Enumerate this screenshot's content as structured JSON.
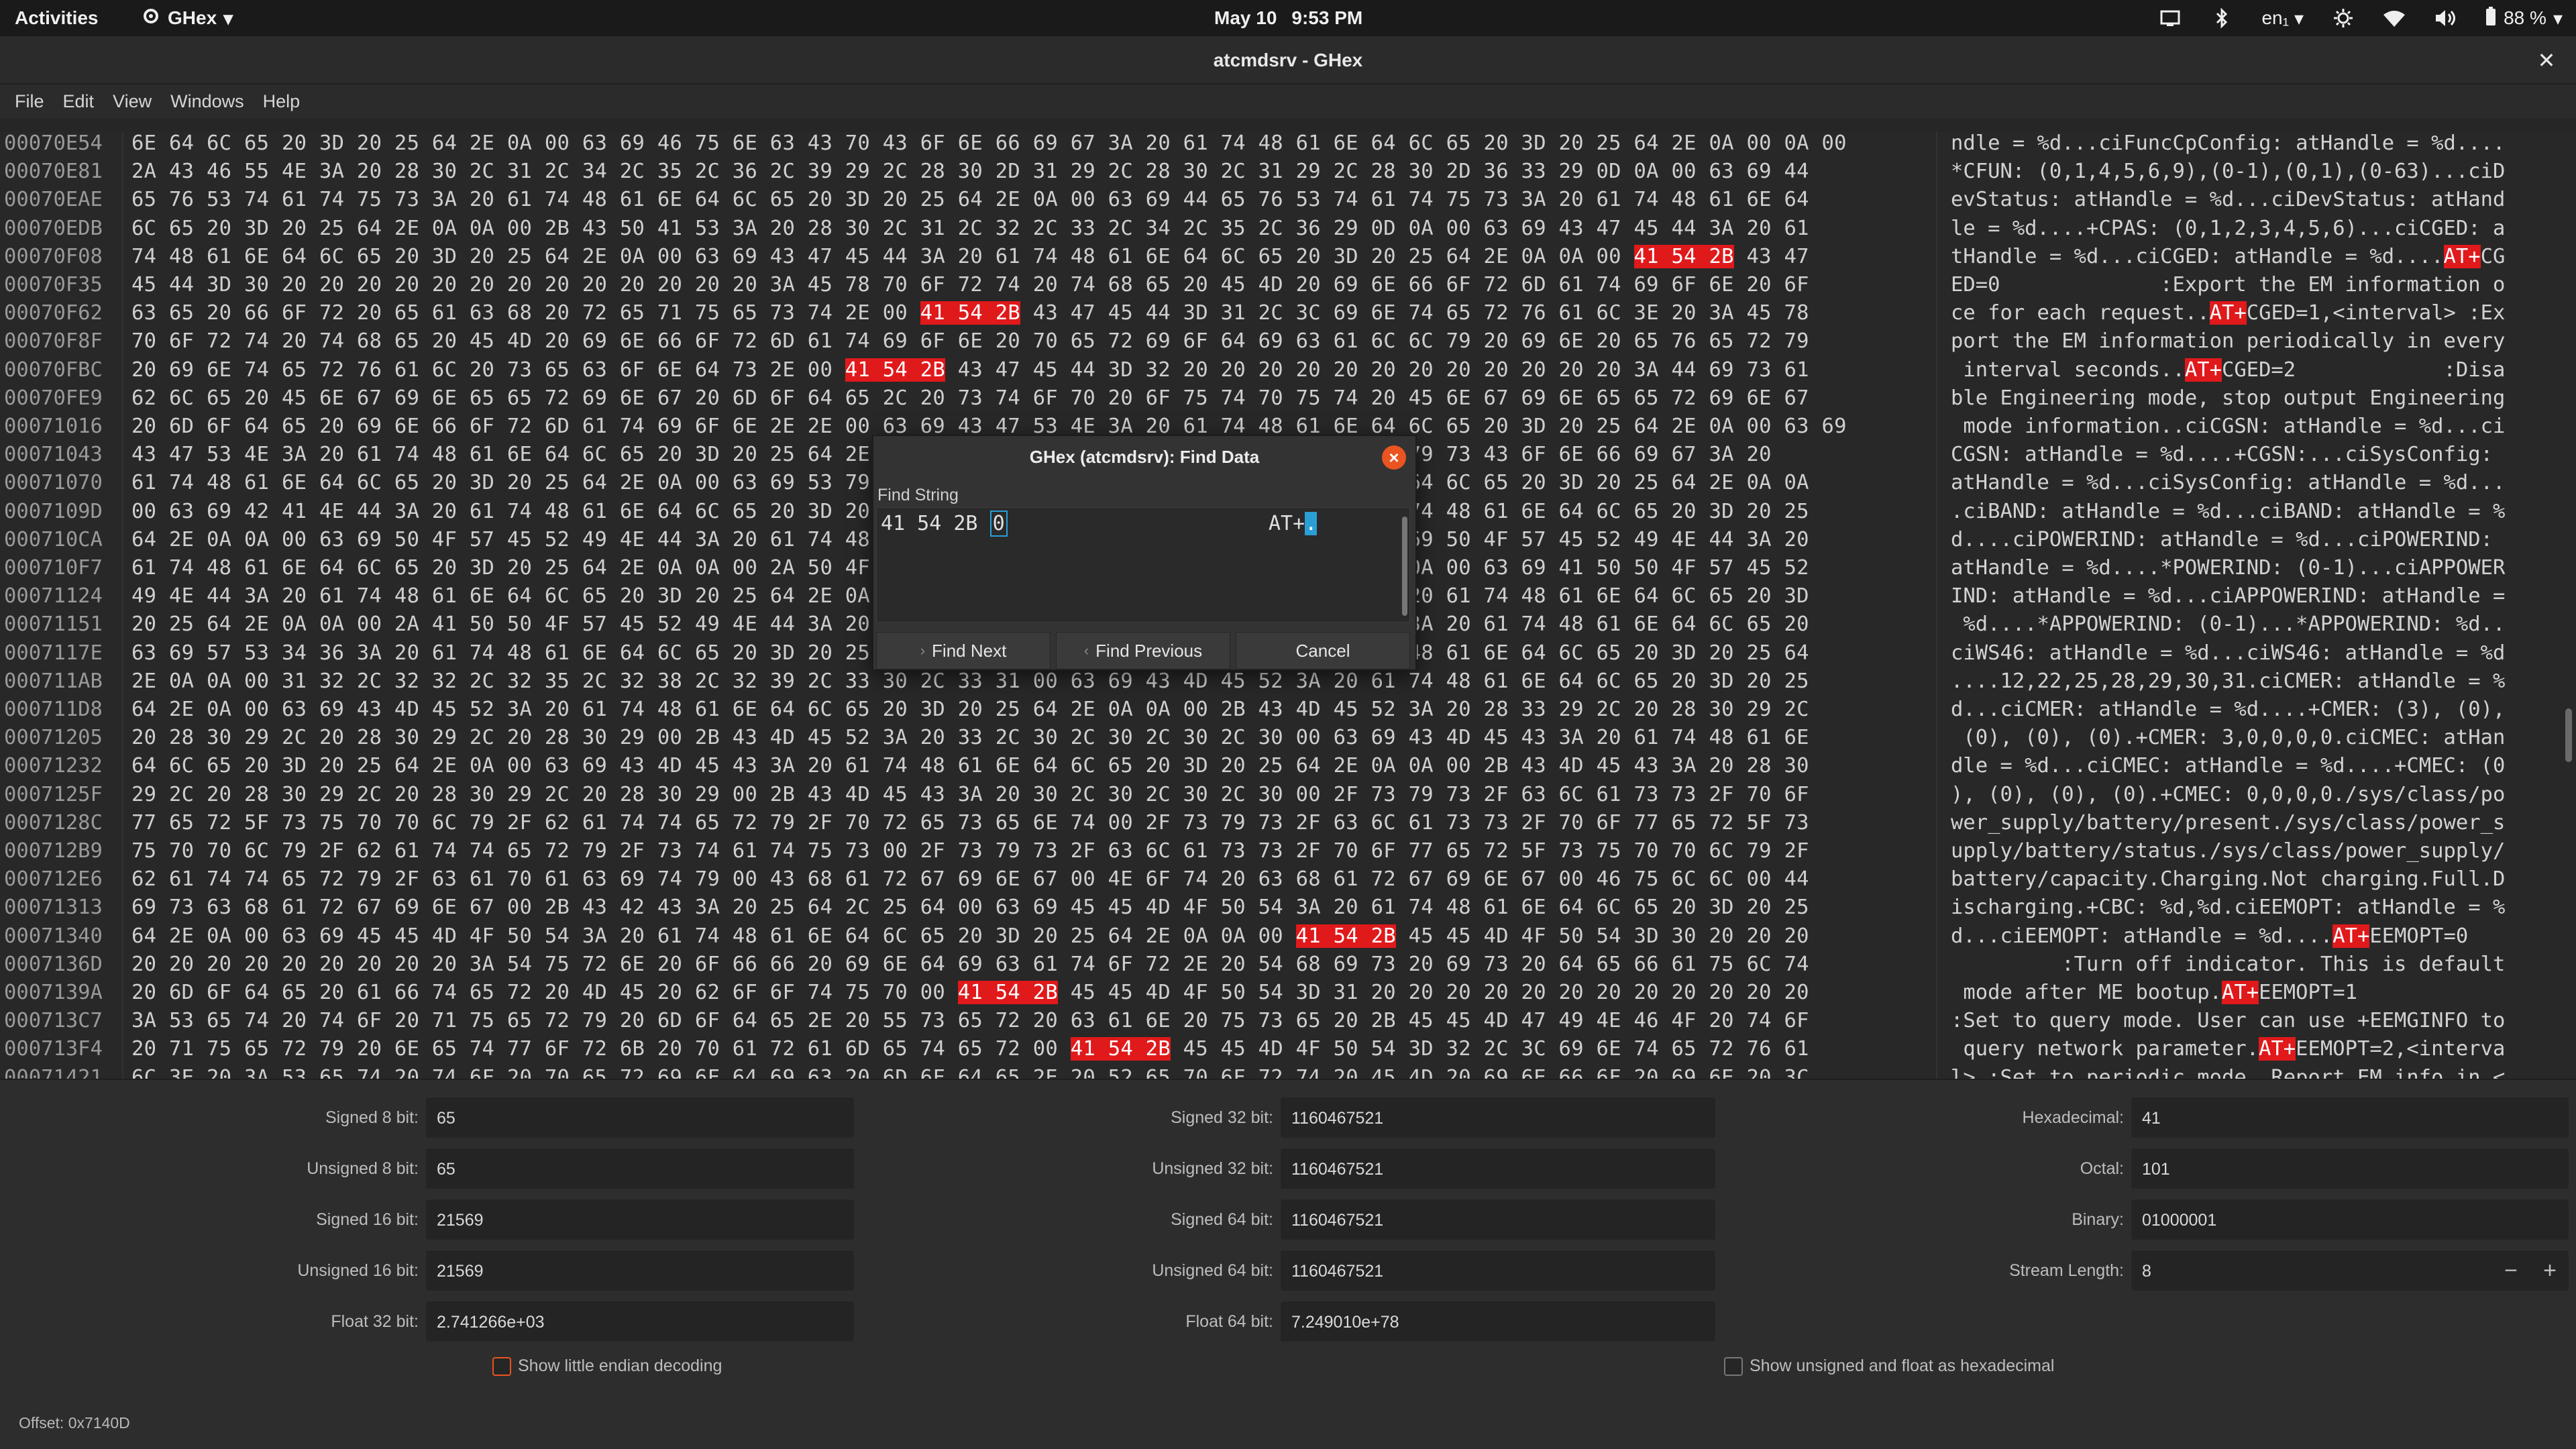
{
  "topbar": {
    "activities": "Activities",
    "app_name": "GHex",
    "date": "May 10",
    "time": "9:53 PM",
    "language": "en₁",
    "battery": "88 %"
  },
  "window": {
    "title": "atcmdsrv - GHex"
  },
  "menu": [
    "File",
    "Edit",
    "View",
    "Windows",
    "Help"
  ],
  "hex_rows": [
    {
      "offset": "00070E54",
      "hex": "6E 64 6C 65 20 3D 20 25 64 2E 0A 00 63 69 46 75 6E 63 43 70 43 6F 6E 66 69 67 3A 20 61 74 48 61 6E 64 6C 65 20 3D 20 25 64 2E 0A 00 0A 00",
      "ascii": "ndle = %d...ciFuncCpConfig: atHandle = %d...."
    },
    {
      "offset": "00070E81",
      "hex": "2A 43 46 55 4E 3A 20 28 30 2C 31 2C 34 2C 35 2C 36 2C 39 29 2C 28 30 2D 31 29 2C 28 30 2C 31 29 2C 28 30 2D 36 33 29 0D 0A 00 63 69 44",
      "ascii": "*CFUN: (0,1,4,5,6,9),(0-1),(0,1),(0-63)...ciD"
    },
    {
      "offset": "00070EAE",
      "hex": "65 76 53 74 61 74 75 73 3A 20 61 74 48 61 6E 64 6C 65 20 3D 20 25 64 2E 0A 00 63 69 44 65 76 53 74 61 74 75 73 3A 20 61 74 48 61 6E 64",
      "ascii": "evStatus: atHandle = %d...ciDevStatus: atHand"
    },
    {
      "offset": "00070EDB",
      "hex": "6C 65 20 3D 20 25 64 2E 0A 0A 00 2B 43 50 41 53 3A 20 28 30 2C 31 2C 32 2C 33 2C 34 2C 35 2C 36 29 0D 0A 00 63 69 43 47 45 44 3A 20 61",
      "ascii": "le = %d....+CPAS: (0,1,2,3,4,5,6)...ciCGED: a"
    },
    {
      "offset": "00070F08",
      "hex": "74 48 61 6E 64 6C 65 20 3D 20 25 64 2E 0A 00 63 69 43 47 45 44 3A 20 61 74 48 61 6E 64 6C 65 20 3D 20 25 64 2E 0A 0A 00 41 54 2B 43 47",
      "ascii": "tHandle = %d...ciCGED: atHandle = %d....AT+CG"
    },
    {
      "offset": "00070F35",
      "hex": "45 44 3D 30 20 20 20 20 20 20 20 20 20 20 20 20 20 3A 45 78 70 6F 72 74 20 74 68 65 20 45 4D 20 69 6E 66 6F 72 6D 61 74 69 6F 6E 20 6F",
      "ascii": "ED=0             :Export the EM information o"
    },
    {
      "offset": "00070F62",
      "hex": "63 65 20 66 6F 72 20 65 61 63 68 20 72 65 71 75 65 73 74 2E 00 41 54 2B 43 47 45 44 3D 31 2C 3C 69 6E 74 65 72 76 61 6C 3E 20 3A 45 78",
      "ascii": "ce for each request..AT+CGED=1,<interval> :Ex"
    },
    {
      "offset": "00070F8F",
      "hex": "70 6F 72 74 20 74 68 65 20 45 4D 20 69 6E 66 6F 72 6D 61 74 69 6F 6E 20 70 65 72 69 6F 64 69 63 61 6C 6C 79 20 69 6E 20 65 76 65 72 79",
      "ascii": "port the EM information periodically in every"
    },
    {
      "offset": "00070FBC",
      "hex": "20 69 6E 74 65 72 76 61 6C 20 73 65 63 6F 6E 64 73 2E 00 41 54 2B 43 47 45 44 3D 32 20 20 20 20 20 20 20 20 20 20 20 20 3A 44 69 73 61",
      "ascii": " interval seconds..AT+CGED=2            :Disa"
    },
    {
      "offset": "00070FE9",
      "hex": "62 6C 65 20 45 6E 67 69 6E 65 65 72 69 6E 67 20 6D 6F 64 65 2C 20 73 74 6F 70 20 6F 75 74 70 75 74 20 45 6E 67 69 6E 65 65 72 69 6E 67",
      "ascii": "ble Engineering mode, stop output Engineering"
    },
    {
      "offset": "00071016",
      "hex": "20 6D 6F 64 65 20 69 6E 66 6F 72 6D 61 74 69 6F 6E 2E 2E 00 63 69 43 47 53 4E 3A 20 61 74 48 61 6E 64 6C 65 20 3D 20 25 64 2E 0A 00 63 69",
      "ascii": " mode information..ciCGSN: atHandle = %d...ci"
    },
    {
      "offset": "00071043",
      "hex": "43 47 53 4E 3A 20 61 74 48 61 6E 64 6C 65 20 3D 20 25 64 2E 0A 0A 00 2B 43 47 53 4E 3A 0A 00 63 69 53 79 73 43 6F 6E 66 69 67 3A 20",
      "ascii": "CGSN: atHandle = %d....+CGSN:...ciSysConfig: "
    },
    {
      "offset": "00071070",
      "hex": "61 74 48 61 6E 64 6C 65 20 3D 20 25 64 2E 0A 00 63 69 53 79 73 43 6F 6E 66 69 67 3A 20 61 74 48 61 6E 64 6C 65 20 3D 20 25 64 2E 0A 0A",
      "ascii": "atHandle = %d...ciSysConfig: atHandle = %d..."
    },
    {
      "offset": "0007109D",
      "hex": "00 63 69 42 41 4E 44 3A 20 61 74 48 61 6E 64 6C 65 20 3D 20 25 64 2E 0A 00 63 69 42 41 4E 44 3A 20 61 74 48 61 6E 64 6C 65 20 3D 20 25",
      "ascii": ".ciBAND: atHandle = %d...ciBAND: atHandle = %"
    },
    {
      "offset": "000710CA",
      "hex": "64 2E 0A 0A 00 63 69 50 4F 57 45 52 49 4E 44 3A 20 61 74 48 61 6E 64 6C 65 20 3D 20 25 64 2E 0A 00 63 69 50 4F 57 45 52 49 4E 44 3A 20",
      "ascii": "d....ciPOWERIND: atHandle = %d...ciPOWERIND: "
    },
    {
      "offset": "000710F7",
      "hex": "61 74 48 61 6E 64 6C 65 20 3D 20 25 64 2E 0A 0A 00 2A 50 4F 57 45 52 49 4E 44 3A 20 28 30 2D 31 29 0D 0A 00 63 69 41 50 50 4F 57 45 52",
      "ascii": "atHandle = %d....*POWERIND: (0-1)...ciAPPOWER"
    },
    {
      "offset": "00071124",
      "hex": "49 4E 44 3A 20 61 74 48 61 6E 64 6C 65 20 3D 20 25 64 2E 0A 00 63 69 41 50 50 4F 57 45 52 49 4E 44 3A 20 61 74 48 61 6E 64 6C 65 20 3D",
      "ascii": "IND: atHandle = %d...ciAPPOWERIND: atHandle ="
    },
    {
      "offset": "00071151",
      "hex": "20 25 64 2E 0A 0A 00 2A 41 50 50 4F 57 45 52 49 4E 44 3A 20 28 30 2D 31 29 0D 0A 00 63 69 57 53 34 36 3A 20 61 74 48 61 6E 64 6C 65 20",
      "ascii": " %d....*APPOWERIND: (0-1)...*APPOWERIND: %d.."
    },
    {
      "offset": "0007117E",
      "hex": "63 69 57 53 34 36 3A 20 61 74 48 61 6E 64 6C 65 20 3D 20 25 64 2E 0A 00 63 69 57 53 34 36 3A 20 61 74 48 61 6E 64 6C 65 20 3D 20 25 64",
      "ascii": "ciWS46: atHandle = %d...ciWS46: atHandle = %d"
    },
    {
      "offset": "000711AB",
      "hex": "2E 0A 0A 00 31 32 2C 32 32 2C 32 35 2C 32 38 2C 32 39 2C 33 30 2C 33 31 00 63 69 43 4D 45 52 3A 20 61 74 48 61 6E 64 6C 65 20 3D 20 25",
      "ascii": "....12,22,25,28,29,30,31.ciCMER: atHandle = %"
    },
    {
      "offset": "000711D8",
      "hex": "64 2E 0A 00 63 69 43 4D 45 52 3A 20 61 74 48 61 6E 64 6C 65 20 3D 20 25 64 2E 0A 0A 00 2B 43 4D 45 52 3A 20 28 33 29 2C 20 28 30 29 2C",
      "ascii": "d...ciCMER: atHandle = %d....+CMER: (3), (0),"
    },
    {
      "offset": "00071205",
      "hex": "20 28 30 29 2C 20 28 30 29 2C 20 28 30 29 00 2B 43 4D 45 52 3A 20 33 2C 30 2C 30 2C 30 2C 30 00 63 69 43 4D 45 43 3A 20 61 74 48 61 6E",
      "ascii": " (0), (0), (0).+CMER: 3,0,0,0,0.ciCMEC: atHan"
    },
    {
      "offset": "00071232",
      "hex": "64 6C 65 20 3D 20 25 64 2E 0A 00 63 69 43 4D 45 43 3A 20 61 74 48 61 6E 64 6C 65 20 3D 20 25 64 2E 0A 0A 00 2B 43 4D 45 43 3A 20 28 30",
      "ascii": "dle = %d...ciCMEC: atHandle = %d....+CMEC: (0"
    },
    {
      "offset": "0007125F",
      "hex": "29 2C 20 28 30 29 2C 20 28 30 29 2C 20 28 30 29 00 2B 43 4D 45 43 3A 20 30 2C 30 2C 30 2C 30 00 2F 73 79 73 2F 63 6C 61 73 73 2F 70 6F",
      "ascii": "), (0), (0), (0).+CMEC: 0,0,0,0./sys/class/po"
    },
    {
      "offset": "0007128C",
      "hex": "77 65 72 5F 73 75 70 70 6C 79 2F 62 61 74 74 65 72 79 2F 70 72 65 73 65 6E 74 00 2F 73 79 73 2F 63 6C 61 73 73 2F 70 6F 77 65 72 5F 73",
      "ascii": "wer_supply/battery/present./sys/class/power_s"
    },
    {
      "offset": "000712B9",
      "hex": "75 70 70 6C 79 2F 62 61 74 74 65 72 79 2F 73 74 61 74 75 73 00 2F 73 79 73 2F 63 6C 61 73 73 2F 70 6F 77 65 72 5F 73 75 70 70 6C 79 2F",
      "ascii": "upply/battery/status./sys/class/power_supply/"
    },
    {
      "offset": "000712E6",
      "hex": "62 61 74 74 65 72 79 2F 63 61 70 61 63 69 74 79 00 43 68 61 72 67 69 6E 67 00 4E 6F 74 20 63 68 61 72 67 69 6E 67 00 46 75 6C 6C 00 44",
      "ascii": "battery/capacity.Charging.Not charging.Full.D"
    },
    {
      "offset": "00071313",
      "hex": "69 73 63 68 61 72 67 69 6E 67 00 2B 43 42 43 3A 20 25 64 2C 25 64 00 63 69 45 45 4D 4F 50 54 3A 20 61 74 48 61 6E 64 6C 65 20 3D 20 25",
      "ascii": "ischarging.+CBC: %d,%d.ciEEMOPT: atHandle = %"
    },
    {
      "offset": "00071340",
      "hex": "64 2E 0A 00 63 69 45 45 4D 4F 50 54 3A 20 61 74 48 61 6E 64 6C 65 20 3D 20 25 64 2E 0A 0A 00 41 54 2B 45 45 4D 4F 50 54 3D 30 20 20 20",
      "ascii": "d...ciEEMOPT: atHandle = %d....AT+EEMOPT=0   "
    },
    {
      "offset": "0007136D",
      "hex": "20 20 20 20 20 20 20 20 20 3A 54 75 72 6E 20 6F 66 66 20 69 6E 64 69 63 61 74 6F 72 2E 20 54 68 69 73 20 69 73 20 64 65 66 61 75 6C 74",
      "ascii": "         :Turn off indicator. This is default"
    },
    {
      "offset": "0007139A",
      "hex": "20 6D 6F 64 65 20 61 66 74 65 72 20 4D 45 20 62 6F 6F 74 75 70 00 41 54 2B 45 45 4D 4F 50 54 3D 31 20 20 20 20 20 20 20 20 20 20 20 20",
      "ascii": " mode after ME bootup.AT+EEMOPT=1            "
    },
    {
      "offset": "000713C7",
      "hex": "3A 53 65 74 20 74 6F 20 71 75 65 72 79 20 6D 6F 64 65 2E 20 55 73 65 72 20 63 61 6E 20 75 73 65 20 2B 45 45 4D 47 49 4E 46 4F 20 74 6F",
      "ascii": ":Set to query mode. User can use +EEMGINFO to"
    },
    {
      "offset": "000713F4",
      "hex": "20 71 75 65 72 79 20 6E 65 74 77 6F 72 6B 20 70 61 72 61 6D 65 74 65 72 00 41 54 2B 45 45 4D 4F 50 54 3D 32 2C 3C 69 6E 74 65 72 76 61",
      "ascii": " query network parameter.AT+EEMOPT=2,<interva"
    },
    {
      "offset": "00071421",
      "hex": "6C 3E 20 3A 53 65 74 20 74 6F 20 70 65 72 69 6F 64 69 63 20 6D 6F 64 65 2E 20 52 65 70 6F 72 74 20 45 4D 20 69 6E 66 6F 20 69 6E 20 3C",
      "ascii": "l> :Set to periodic mode. Report EM info in <"
    }
  ],
  "find_dialog": {
    "title": "GHex (atcmdsrv): Find Data",
    "label": "Find String",
    "hex_value": "41 54 2B",
    "hex_cursor": "0",
    "ascii_value": "AT+",
    "ascii_cursor": ".",
    "find_next": "Find Next",
    "find_previous": "Find Previous",
    "cancel": "Cancel"
  },
  "converter": {
    "signed_8_label": "Signed 8 bit:",
    "signed_8": "65",
    "unsigned_8_label": "Unsigned 8 bit:",
    "unsigned_8": "65",
    "signed_16_label": "Signed 16 bit:",
    "signed_16": "21569",
    "unsigned_16_label": "Unsigned 16 bit:",
    "unsigned_16": "21569",
    "float_32_label": "Float 32 bit:",
    "float_32": "2.741266e+03",
    "signed_32_label": "Signed 32 bit:",
    "signed_32": "1160467521",
    "unsigned_32_label": "Unsigned 32 bit:",
    "unsigned_32": "1160467521",
    "signed_64_label": "Signed 64 bit:",
    "signed_64": "1160467521",
    "unsigned_64_label": "Unsigned 64 bit:",
    "unsigned_64": "1160467521",
    "float_64_label": "Float 64 bit:",
    "float_64": "7.249010e+78",
    "hex_label": "Hexadecimal:",
    "hex": "41",
    "octal_label": "Octal:",
    "octal": "101",
    "binary_label": "Binary:",
    "binary": "01000001",
    "stream_label": "Stream Length:",
    "stream": "8",
    "little_endian_label": "Show little endian decoding",
    "unsigned_hex_label": "Show unsigned and float as hexadecimal"
  },
  "statusbar": {
    "offset": "Offset: 0x7140D"
  }
}
